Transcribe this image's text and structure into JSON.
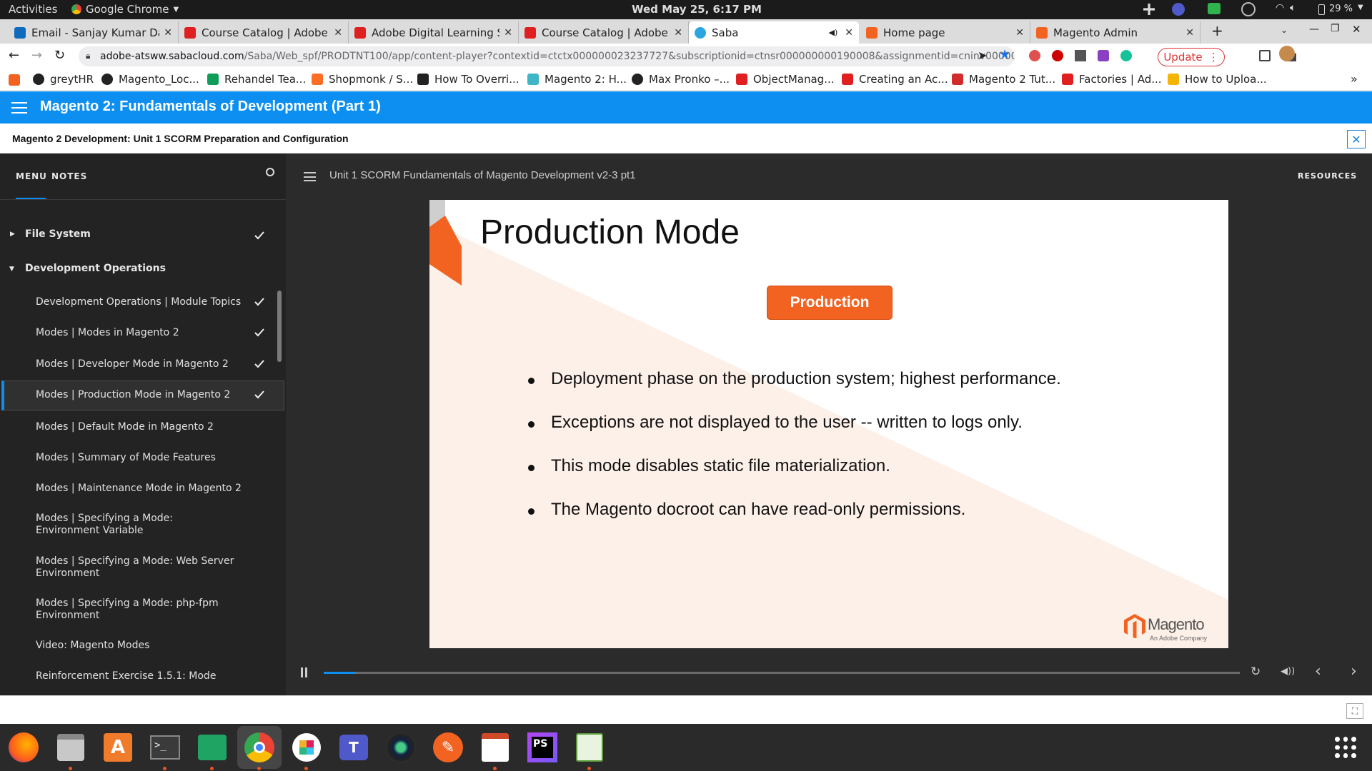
{
  "system": {
    "activities": "Activities",
    "app_menu": "Google Chrome",
    "clock": "Wed May 25,  6:17 PM",
    "battery": "29 %"
  },
  "tabs": [
    {
      "title": "Email - Sanjay Kumar Das",
      "color": "#0f6cbd"
    },
    {
      "title": "Course Catalog | Adobe D",
      "color": "#e02020"
    },
    {
      "title": "Adobe Digital Learning Se",
      "color": "#e02020"
    },
    {
      "title": "Course Catalog | Adobe D",
      "color": "#e02020"
    },
    {
      "title": "Saba",
      "color": "#2ba6e0"
    },
    {
      "title": "Home page",
      "color": "#f26322"
    },
    {
      "title": "Magento Admin",
      "color": "#f26322"
    }
  ],
  "address": {
    "url_host": "adobe-atsww.sabacloud.com",
    "url_path": "/Saba/Web_spf/PRODTNT100/app/content-player?contextid=ctctx000000023237727&subscriptionid=ctnsr000000000190008&assignmentid=cninv00000000007...",
    "update_label": "Update"
  },
  "bookmarks": [
    "greytHR",
    "Magento_Loc...",
    "Rehandel Tea...",
    "Shopmonk / S...",
    "How To Overri...",
    "Magento 2: H...",
    "Max Pronko –...",
    "ObjectManag...",
    "Creating an Ac...",
    "Magento 2 Tut...",
    "Factories | Ad...",
    "How to Uploa..."
  ],
  "app": {
    "title": "Magento 2: Fundamentals of Development (Part 1)",
    "subtitle": "Magento 2 Development: Unit 1 SCORM Preparation and Configuration"
  },
  "sidebar": {
    "tab_menu": "MENU",
    "tab_notes": "NOTES",
    "sections": [
      {
        "label": "File System",
        "completed": true,
        "expanded": false
      },
      {
        "label": "Development Operations",
        "completed": false,
        "expanded": true
      }
    ],
    "items": [
      {
        "label": "Development Operations | Module Topics",
        "completed": true
      },
      {
        "label": "Modes | Modes in Magento 2",
        "completed": true
      },
      {
        "label": "Modes | Developer Mode in Magento 2",
        "completed": true
      },
      {
        "label": "Modes | Production Mode in Magento 2",
        "completed": true,
        "active": true
      },
      {
        "label": "Modes | Default Mode in Magento 2",
        "completed": false
      },
      {
        "label": "Modes | Summary of Mode Features",
        "completed": false
      },
      {
        "label": "Modes | Maintenance Mode in Magento 2",
        "completed": false
      },
      {
        "label": "Modes | Specifying a Mode: Environment Variable",
        "completed": false
      },
      {
        "label": "Modes | Specifying a Mode: Web Server Environment",
        "completed": false
      },
      {
        "label": "Modes | Specifying a Mode: php-fpm Environment",
        "completed": false
      },
      {
        "label": "Video: Magento Modes",
        "completed": false
      },
      {
        "label": "Reinforcement Exercise 1.5.1: Mode",
        "completed": false
      }
    ]
  },
  "player": {
    "title": "Unit 1 SCORM Fundamentals of Magento Development v2-3 pt1",
    "resources": "RESOURCES",
    "progress": 0.035
  },
  "slide": {
    "heading": "Production Mode",
    "badge": "Production",
    "bullets": [
      "Deployment phase on the production system; highest performance.",
      "Exceptions are not displayed to the user -- written to logs only.",
      "This mode disables static file materialization.",
      "The Magento docroot can have read-only permissions."
    ],
    "logo_text": "Magento",
    "logo_sub": "An Adobe Company",
    "accent": "#f26322"
  },
  "taskbar_apps": [
    "firefox-icon",
    "files-icon",
    "software-icon",
    "terminal-icon",
    "chat-icon",
    "chrome-icon",
    "slack-icon",
    "teams-icon",
    "camera-icon",
    "inkscape-icon",
    "editor-icon",
    "phpstorm-icon",
    "spreadsheet-icon"
  ]
}
